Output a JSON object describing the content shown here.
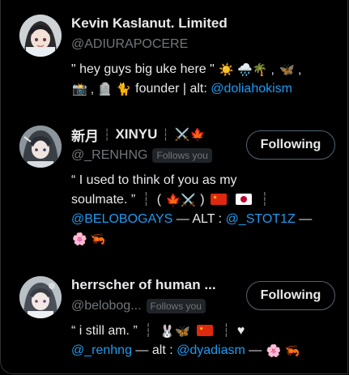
{
  "users": [
    {
      "display_name": "Kevin Kaslanut. Limited",
      "handle": "@ADIURAPOCERE",
      "bio_intro": "\" hey guys big uke here \"",
      "bio_emoji_a": "☀️ 🌧️🌴 ,",
      "bio_emoji_b": "🦋 ,",
      "bio_emoji_c": "📸 , 🪦 🐈",
      "bio_founder": "founder | alt:",
      "bio_link": "@doliahokism"
    },
    {
      "display_name_main": "新月",
      "display_name_sep": "┆",
      "display_name_xinyu": "XINYU",
      "display_name_sep2": "┆",
      "display_name_emoji": "⚔️🍁",
      "handle": "@_RENHNG",
      "follows_badge": "Follows you",
      "follow_button": "Following",
      "bio_line1": "“ I used to think of you as my",
      "bio_line2_text": "soulmate. ”",
      "bio_sep1": "┆",
      "bio_paren_open": "(",
      "bio_paren_emoji": "🍁⚔️",
      "bio_paren_close": ")",
      "bio_sep2": "┆",
      "bio_link1": "@BELOBOGAYS",
      "bio_alt": "— ALT :",
      "bio_link2": "@_STOT1Z",
      "bio_dash": "—",
      "bio_tail_emoji": "🌸 🦐"
    },
    {
      "display_name": "herrscher of human ...",
      "handle": "@belobog...",
      "follows_badge": "Follows you",
      "follow_button": "Following",
      "bio_text": "“ i still am. ”",
      "bio_sep1": "┆",
      "bio_emoji": "🐰🦋",
      "bio_sep2": "┆",
      "bio_heart": "♥",
      "bio_link1": "@_renhng",
      "bio_alt": "— alt :",
      "bio_link2": "@dyadiasm",
      "bio_dash": "—",
      "bio_tail_emoji": "🌸 🦐"
    }
  ],
  "colors": {
    "background": "#000000",
    "text": "#e7e9ea",
    "secondary": "#71767b",
    "link": "#1d9bf0",
    "border": "#536471"
  }
}
